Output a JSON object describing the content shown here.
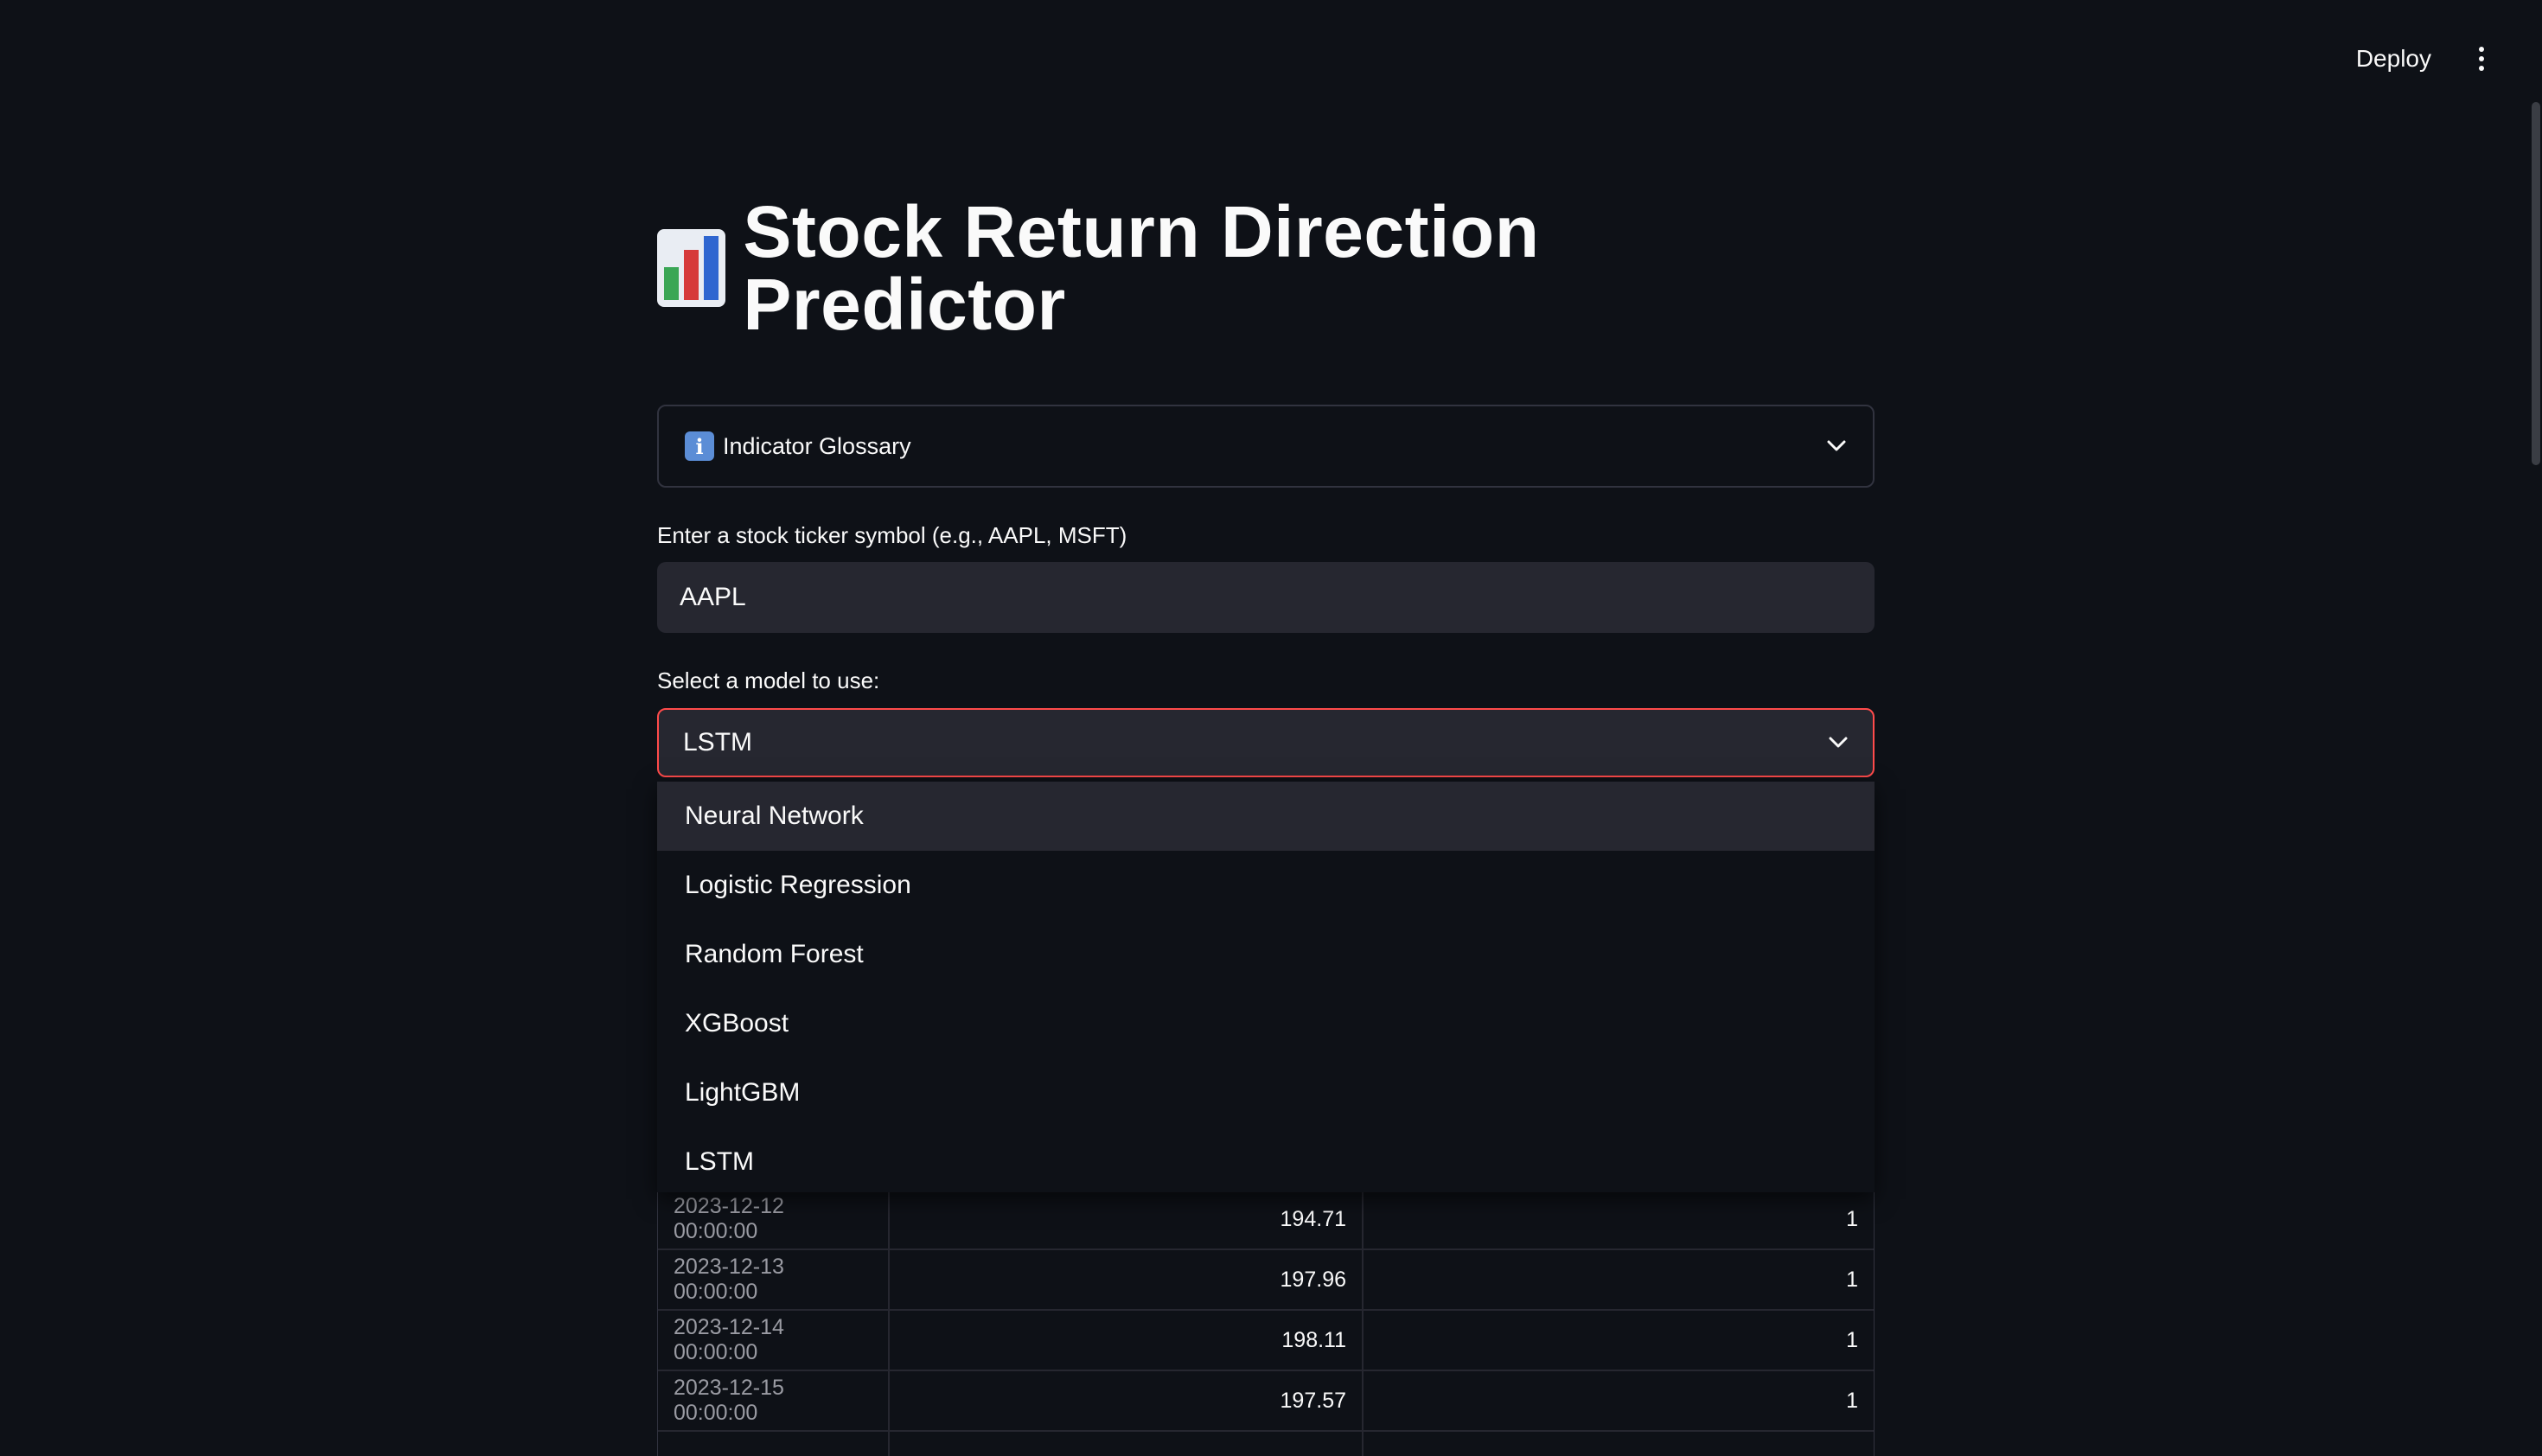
{
  "header": {
    "deploy_label": "Deploy"
  },
  "main": {
    "title": "Stock Return Direction Predictor",
    "title_icon": "bar-chart-emoji",
    "glossary": {
      "icon": "info-icon",
      "icon_glyph": "i",
      "label": "Indicator Glossary"
    },
    "ticker": {
      "label": "Enter a stock ticker symbol (e.g., AAPL, MSFT)",
      "value": "AAPL"
    },
    "model_select": {
      "label": "Select a model to use:",
      "selected": "LSTM",
      "options": [
        "Neural Network",
        "Logistic Regression",
        "Random Forest",
        "XGBoost",
        "LightGBM",
        "LSTM"
      ],
      "highlighted_index": 0
    },
    "table": {
      "rows": [
        [
          "2023-12-12 00:00:00",
          "194.71",
          "1"
        ],
        [
          "2023-12-13 00:00:00",
          "197.96",
          "1"
        ],
        [
          "2023-12-14 00:00:00",
          "198.11",
          "1"
        ],
        [
          "2023-12-15 00:00:00",
          "197.57",
          "1"
        ],
        [
          "",
          "",
          ""
        ]
      ]
    }
  },
  "colors": {
    "background": "#0e1117",
    "input_bg": "#262730",
    "accent_border": "#ff4b4b",
    "text": "#fafafa"
  }
}
